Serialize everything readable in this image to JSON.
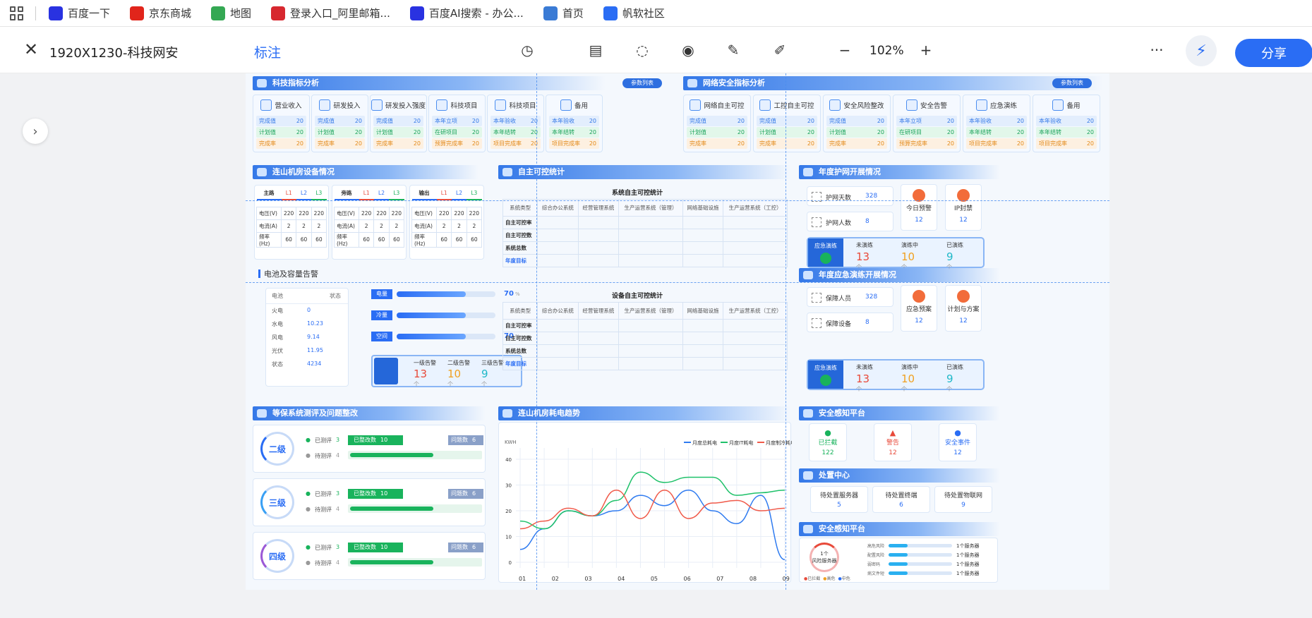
{
  "bookmarks": [
    {
      "label": "百度一下",
      "icon": "baidu-paw-icon",
      "color": "#2932e1"
    },
    {
      "label": "京东商城",
      "icon": "jd-logo-icon",
      "color": "#e1251b"
    },
    {
      "label": "地图",
      "icon": "map-pin-icon",
      "color": "#34a853"
    },
    {
      "label": "登录入口_阿里邮箱...",
      "icon": "aliyun-mail-icon",
      "color": "#d7282f"
    },
    {
      "label": "百度AI搜索 - 办公...",
      "icon": "baidu-paw-icon",
      "color": "#2932e1"
    },
    {
      "label": "首页",
      "icon": "home-globe-icon",
      "color": "#3a7bd5"
    },
    {
      "label": "帆软社区",
      "icon": "fanruan-logo-icon",
      "color": "#2a6df4"
    }
  ],
  "toolbar": {
    "close": "✕",
    "filename": "1920X1230-科技网安",
    "tab": "标注",
    "zoom": "102%",
    "minus": "−",
    "plus": "+",
    "more": "···",
    "share": "分享"
  },
  "dash": {
    "tech": {
      "title": "科技指标分析",
      "btn": "参数列表"
    },
    "net": {
      "title": "网络安全指标分析",
      "btn": "参数列表"
    },
    "kpis": [
      {
        "title": "营业收入",
        "rows": [
          [
            "完成值",
            "20"
          ],
          [
            "计划值",
            "20"
          ],
          [
            "完成率",
            "20"
          ]
        ]
      },
      {
        "title": "研发投入",
        "rows": [
          [
            "完成值",
            "20"
          ],
          [
            "计划值",
            "20"
          ],
          [
            "完成率",
            "20"
          ]
        ]
      },
      {
        "title": "研发投入强度",
        "rows": [
          [
            "完成值",
            "20"
          ],
          [
            "计划值",
            "20"
          ],
          [
            "完成率",
            "20"
          ]
        ]
      },
      {
        "title": "科技项目",
        "rows": [
          [
            "本年立项",
            "20"
          ],
          [
            "在研项目",
            "20"
          ],
          [
            "预算完成率",
            "20"
          ]
        ]
      },
      {
        "title": "科技项目",
        "rows": [
          [
            "本年验收",
            "20"
          ],
          [
            "本年结转",
            "20"
          ],
          [
            "项目完成率",
            "20"
          ]
        ]
      },
      {
        "title": "备用",
        "rows": [
          [
            "本年验收",
            "20"
          ],
          [
            "本年结转",
            "20"
          ],
          [
            "项目完成率",
            "20"
          ]
        ]
      },
      {
        "title": "网络自主可控",
        "rows": [
          [
            "完成值",
            "20"
          ],
          [
            "计划值",
            "20"
          ],
          [
            "完成率",
            "20"
          ]
        ]
      },
      {
        "title": "工控自主可控",
        "rows": [
          [
            "完成值",
            "20"
          ],
          [
            "计划值",
            "20"
          ],
          [
            "完成率",
            "20"
          ]
        ]
      },
      {
        "title": "安全风险整改",
        "rows": [
          [
            "完成值",
            "20"
          ],
          [
            "计划值",
            "20"
          ],
          [
            "完成率",
            "20"
          ]
        ]
      },
      {
        "title": "安全告警",
        "rows": [
          [
            "本年立项",
            "20"
          ],
          [
            "在研项目",
            "20"
          ],
          [
            "预算完成率",
            "20"
          ]
        ]
      },
      {
        "title": "应急演练",
        "rows": [
          [
            "本年验收",
            "20"
          ],
          [
            "本年结转",
            "20"
          ],
          [
            "项目完成率",
            "20"
          ]
        ]
      },
      {
        "title": "备用",
        "rows": [
          [
            "本年验收",
            "20"
          ],
          [
            "本年结转",
            "20"
          ],
          [
            "项目完成率",
            "20"
          ]
        ]
      }
    ],
    "room": {
      "title": "连山机房设备情况",
      "groups": [
        {
          "name": "主路",
          "cols": [
            "L1",
            "L2",
            "L3"
          ]
        },
        {
          "name": "旁路",
          "cols": [
            "L1",
            "L2",
            "L3"
          ]
        },
        {
          "name": "输出",
          "cols": [
            "L1",
            "L2",
            "L3"
          ]
        }
      ],
      "rows": [
        [
          "电压(V)",
          "220",
          "220",
          "220"
        ],
        [
          "电流(A)",
          "2",
          "2",
          "2"
        ],
        [
          "频率(Hz)",
          "60",
          "60",
          "60"
        ]
      ]
    },
    "battery": {
      "title": "电池及容量告警",
      "head": [
        "电池",
        "状态"
      ],
      "items": [
        [
          "火电",
          "0"
        ],
        [
          "水电",
          "10.23"
        ],
        [
          "风电",
          "9.14"
        ],
        [
          "光伏",
          "11.95"
        ],
        [
          "状态",
          "4234"
        ]
      ],
      "gauges": [
        {
          "label": "电量",
          "value": "70",
          "unit": "%",
          "pct": 70
        },
        {
          "label": "冷量",
          "value": "70",
          "unit": "%",
          "pct": 70
        },
        {
          "label": "空间",
          "value": "70",
          "unit": "%",
          "pct": 70
        }
      ],
      "alerts": [
        {
          "label": "一级告警",
          "value": "13",
          "unit": "个"
        },
        {
          "label": "二级告警",
          "value": "10",
          "unit": "个"
        },
        {
          "label": "三级告警",
          "value": "9",
          "unit": "个"
        }
      ]
    },
    "autonomy": {
      "title": "自主可控统计",
      "sys": {
        "caption": "系统自主可控统计",
        "cols": [
          "系统类型",
          "综合办公系统",
          "经营管理系统",
          "生产运营系统（管理）",
          "网络基础设施",
          "生产运营系统（工控）"
        ],
        "rows": [
          "自主可控率",
          "自主可控数",
          "系统总数",
          "年度目标"
        ]
      },
      "dev": {
        "caption": "设备自主可控统计",
        "cols": [
          "系统类型",
          "综合办公系统",
          "经营管理系统",
          "生产运营系统（管理）",
          "网络基础设施",
          "生产运营系统（工控）"
        ],
        "rows": [
          "自主可控率",
          "自主可控数",
          "系统总数",
          "年度目标"
        ]
      }
    },
    "guard": {
      "title": "年度护网开展情况",
      "days_label": "护网天数",
      "days": "328",
      "people_label": "护网人数",
      "people": "8",
      "b1": "今日预警",
      "b1v": "12",
      "b2": "IP封禁",
      "b2v": "12",
      "drill": {
        "label": "应急演练",
        "cols": [
          {
            "l": "未演练",
            "v": "13",
            "u": "个"
          },
          {
            "l": "演练中",
            "v": "10",
            "u": "个"
          },
          {
            "l": "已演练",
            "v": "9",
            "u": "个"
          }
        ]
      }
    },
    "emerg": {
      "title": "年度应急演练开展情况",
      "p_label": "保障人员",
      "p": "328",
      "d_label": "保障设备",
      "d": "8",
      "b1": "应急预案",
      "b1v": "12",
      "b2": "计划与方案",
      "b2v": "12",
      "drill": {
        "label": "应急演练",
        "cols": [
          {
            "l": "未演练",
            "v": "13",
            "u": "个"
          },
          {
            "l": "演练中",
            "v": "10",
            "u": "个"
          },
          {
            "l": "已演练",
            "v": "9",
            "u": "个"
          }
        ]
      }
    },
    "level": {
      "title": "等保系统测评及问题整改",
      "items": [
        {
          "name": "二级",
          "done": "已测评",
          "done_v": "3",
          "todo": "待测评",
          "todo_v": "4",
          "fix": "已整改数",
          "fix_v": "10",
          "issue": "问题数",
          "issue_v": "6",
          "pct": 62
        },
        {
          "name": "三级",
          "done": "已测评",
          "done_v": "3",
          "todo": "待测评",
          "todo_v": "4",
          "fix": "已整改数",
          "fix_v": "10",
          "issue": "问题数",
          "issue_v": "6",
          "pct": 62
        },
        {
          "name": "四级",
          "done": "已测评",
          "done_v": "3",
          "todo": "待测评",
          "todo_v": "4",
          "fix": "已整改数",
          "fix_v": "10",
          "issue": "问题数",
          "issue_v": "6",
          "pct": 62
        }
      ]
    },
    "trend": {
      "title": "连山机房耗电趋势"
    },
    "aware1": {
      "title": "安全感知平台",
      "items": [
        {
          "l": "已拦截",
          "v": "122",
          "c": "#19b35c"
        },
        {
          "l": "警告",
          "v": "12",
          "c": "#e84a3a"
        },
        {
          "l": "安全事件",
          "v": "12",
          "c": "#2a6df4"
        }
      ]
    },
    "dispose": {
      "title": "处置中心",
      "items": [
        {
          "l": "待处置服务器",
          "v": "5"
        },
        {
          "l": "待处置终端",
          "v": "6"
        },
        {
          "l": "待处置物联网",
          "v": "9"
        }
      ]
    },
    "aware2": {
      "title": "安全感知平台",
      "donut": "1个",
      "donut_sub": "风险服务器",
      "legend": [
        "已拦截",
        "高危",
        "中危"
      ],
      "rows": [
        {
          "l": "高危风险",
          "v": "1个服务器",
          "pct": 30
        },
        {
          "l": "配置风险",
          "v": "1个服务器",
          "pct": 30
        },
        {
          "l": "弱密码",
          "v": "1个服务器",
          "pct": 30
        },
        {
          "l": "病文件短",
          "v": "1个服务器",
          "pct": 30
        }
      ]
    }
  },
  "chart_data": {
    "type": "line",
    "ylabel": "KWH",
    "categories": [
      "01",
      "02",
      "03",
      "04",
      "05",
      "06",
      "07",
      "08",
      "09"
    ],
    "ylim": [
      0,
      40
    ],
    "yticks": [
      0,
      10,
      20,
      30,
      40
    ],
    "grid": true,
    "legend_position": "top-right",
    "series": [
      {
        "name": "月度总耗电",
        "color": "#2f7bf0",
        "values": [
          5,
          13,
          20,
          18,
          20,
          26,
          22,
          28,
          20,
          15,
          26,
          1
        ]
      },
      {
        "name": "月度IT耗电",
        "color": "#1fc16a",
        "values": [
          16,
          13,
          20,
          18,
          24,
          35,
          31,
          33,
          33,
          26,
          27,
          28
        ]
      },
      {
        "name": "月度制冷耗电",
        "color": "#f05a4a",
        "values": [
          13,
          16,
          21,
          18,
          28,
          17,
          28,
          17,
          23,
          24,
          20,
          21
        ]
      }
    ]
  }
}
